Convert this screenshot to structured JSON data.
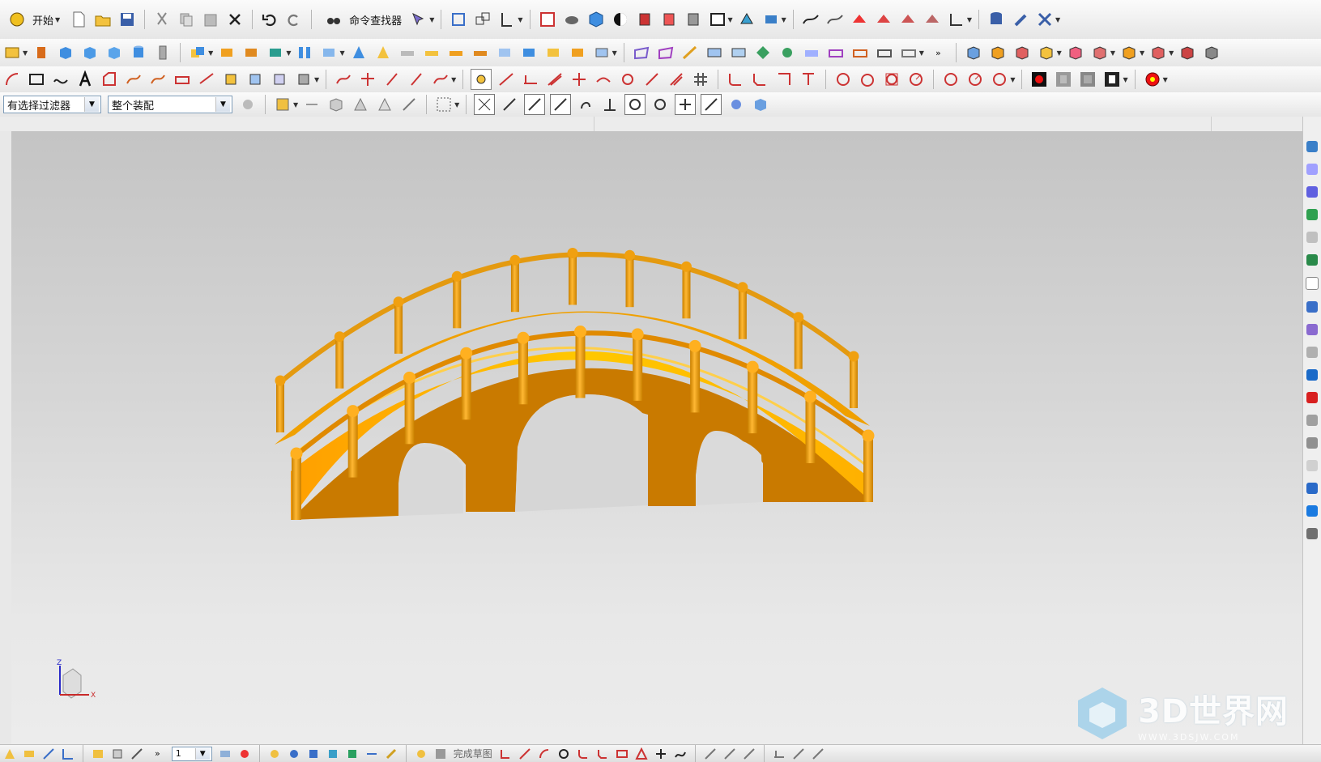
{
  "toolbar_row1": {
    "start_label": "开始",
    "command_finder_label": "命令查找器"
  },
  "selection_bar": {
    "filter_value": "有选择过滤器",
    "scope_value": "整个装配"
  },
  "bottom_toolbar": {
    "finish_sketch_label": "完成草图",
    "layer_value": "1"
  },
  "triad": {
    "x_label": "X",
    "z_label": "Z"
  },
  "watermark": {
    "title": "3D世界网",
    "url": "WWW.3DSJW.COM"
  },
  "colors": {
    "bridge_body": "#c97a00",
    "bridge_face": "#ffc400",
    "bridge_shade": "#e19a00",
    "viewport_top": "#c4c4c4",
    "viewport_bottom": "#ececec"
  }
}
